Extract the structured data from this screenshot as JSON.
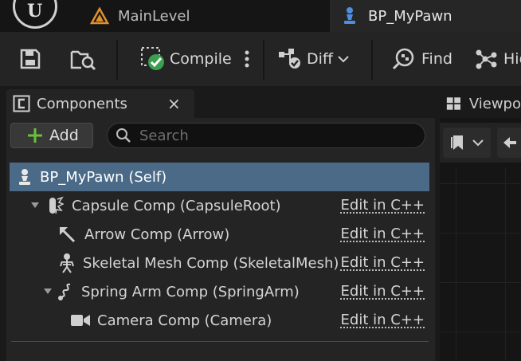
{
  "tabs": {
    "main_level": "MainLevel",
    "blueprint": "BP_MyPawn"
  },
  "toolbar": {
    "compile": "Compile",
    "diff": "Diff",
    "find": "Find",
    "hide_partial": "Hid"
  },
  "components_panel": {
    "title": "Components",
    "close": "×",
    "add": "Add",
    "search_placeholder": "Search",
    "tree": [
      {
        "label": "BP_MyPawn (Self)",
        "edit": ""
      },
      {
        "label": "Capsule Comp (CapsuleRoot)",
        "edit": "Edit in C++"
      },
      {
        "label": "Arrow Comp (Arrow)",
        "edit": "Edit in C++"
      },
      {
        "label": "Skeletal Mesh Comp (SkeletalMesh)",
        "edit": "Edit in C++"
      },
      {
        "label": "Spring Arm Comp (SpringArm)",
        "edit": "Edit in C++"
      },
      {
        "label": "Camera Comp (Camera)",
        "edit": "Edit in C++"
      }
    ]
  },
  "viewport": {
    "tab_partial": "Viewpo"
  },
  "colors": {
    "selected_row": "#4a6a88",
    "pawn_icon_blue": "#4c8fe0",
    "compile_green": "#3aa050",
    "level_orange": "#e0912a",
    "add_plus_green": "#6abf3a"
  }
}
